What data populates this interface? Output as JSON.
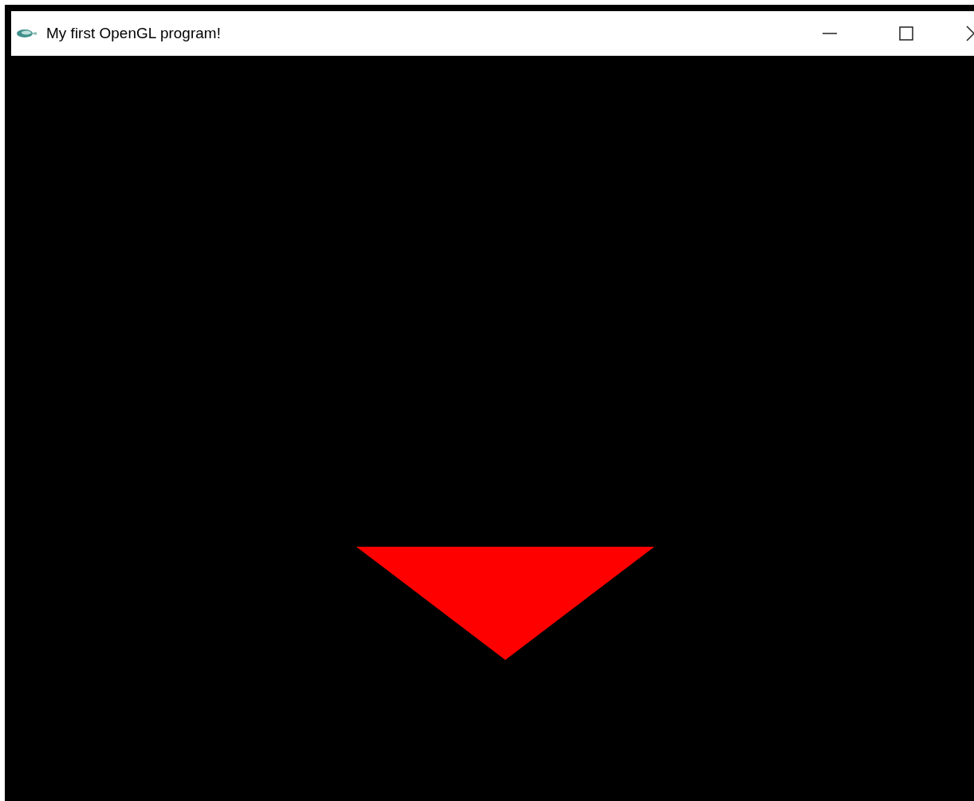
{
  "window": {
    "title": "My first OpenGL program!"
  }
}
